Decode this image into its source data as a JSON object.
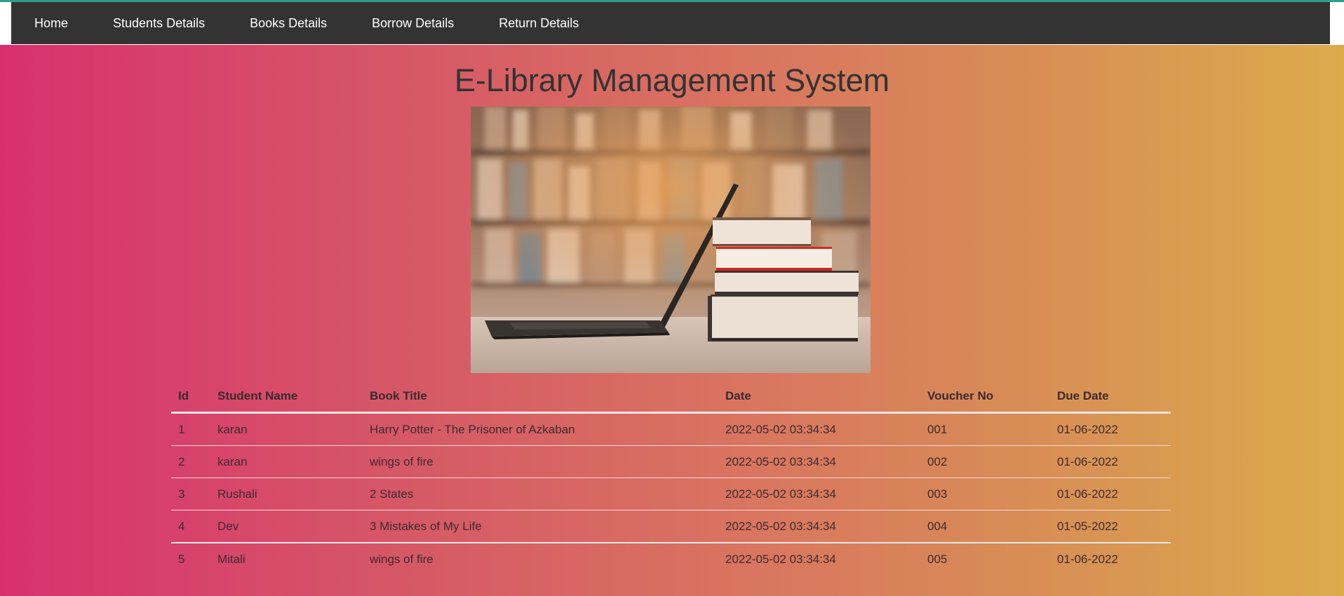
{
  "nav": {
    "items": [
      {
        "label": "Home"
      },
      {
        "label": "Students Details"
      },
      {
        "label": "Books Details"
      },
      {
        "label": "Borrow Details"
      },
      {
        "label": "Return Details"
      }
    ]
  },
  "page": {
    "title": "E-Library Management System"
  },
  "hero_image": {
    "description_icon": "library-books-laptop-photo"
  },
  "table": {
    "headers": [
      "Id",
      "Student Name",
      "Book Title",
      "Date",
      "Voucher No",
      "Due Date"
    ],
    "rows": [
      [
        "1",
        "karan",
        "Harry Potter - The Prisoner of Azkaban",
        "2022-05-02 03:34:34",
        "001",
        "01-06-2022"
      ],
      [
        "2",
        "karan",
        "wings of fire",
        "2022-05-02 03:34:34",
        "002",
        "01-06-2022"
      ],
      [
        "3",
        "Rushali",
        "2 States",
        "2022-05-02 03:34:34",
        "003",
        "01-06-2022"
      ],
      [
        "4",
        "Dev",
        "3 Mistakes of My Life",
        "2022-05-02 03:34:34",
        "004",
        "01-05-2022"
      ],
      [
        "5",
        "Mitali",
        "wings of fire",
        "2022-05-02 03:34:34",
        "005",
        "01-06-2022"
      ]
    ]
  },
  "colors": {
    "navbar": "#333333",
    "gradient_start": "#d8306e",
    "gradient_end": "#dcab4c"
  }
}
